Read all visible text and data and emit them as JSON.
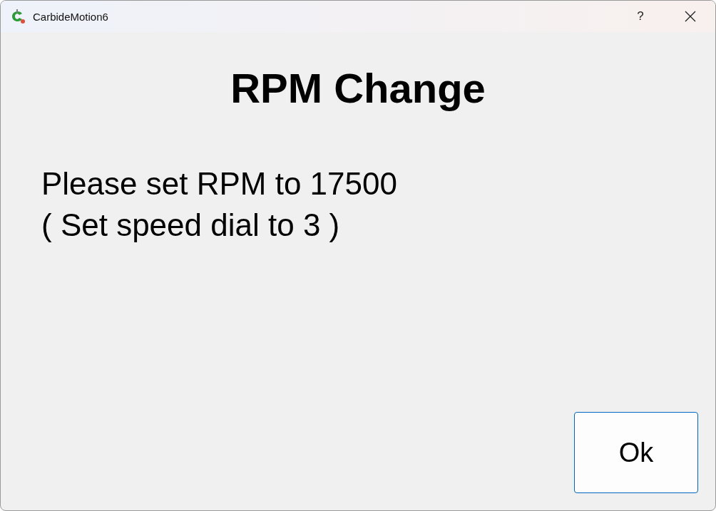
{
  "window": {
    "title": "CarbideMotion6",
    "help": "?"
  },
  "heading": "RPM Change",
  "message": [
    "Please set RPM to 17500",
    "( Set speed dial to 3 )"
  ],
  "buttons": [
    "Ok"
  ]
}
